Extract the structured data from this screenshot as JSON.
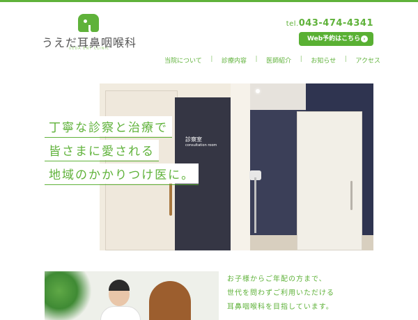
{
  "header": {
    "logo_icon": "elephant-icon",
    "title": "うえだ耳鼻咽喉科",
    "subtitle": "UEDA ENT CLINIC",
    "tel_prefix": "tel.",
    "tel_number": "043-474-4341",
    "web_button": "Web予約はこちら",
    "web_button_icon": "chevron-right-circle-icon"
  },
  "nav": {
    "items": [
      {
        "label": "当院について"
      },
      {
        "label": "診療内容"
      },
      {
        "label": "医師紹介"
      },
      {
        "label": "お知らせ"
      },
      {
        "label": "アクセス"
      }
    ],
    "separator": "|"
  },
  "hero": {
    "line1": "丁寧な診察と治療で",
    "line2": "皆さまに愛される",
    "line3": "地域のかかりつけ医に。",
    "sign_jp": "診察室",
    "sign_en": "consultation room"
  },
  "intro": {
    "line1": "お子様からご年配の方まで、",
    "line2": "世代を問わずご利用いただける",
    "line3": "耳鼻咽喉科を目指しています。"
  },
  "colors": {
    "accent": "#5fb23a",
    "navy": "#2f3450"
  }
}
